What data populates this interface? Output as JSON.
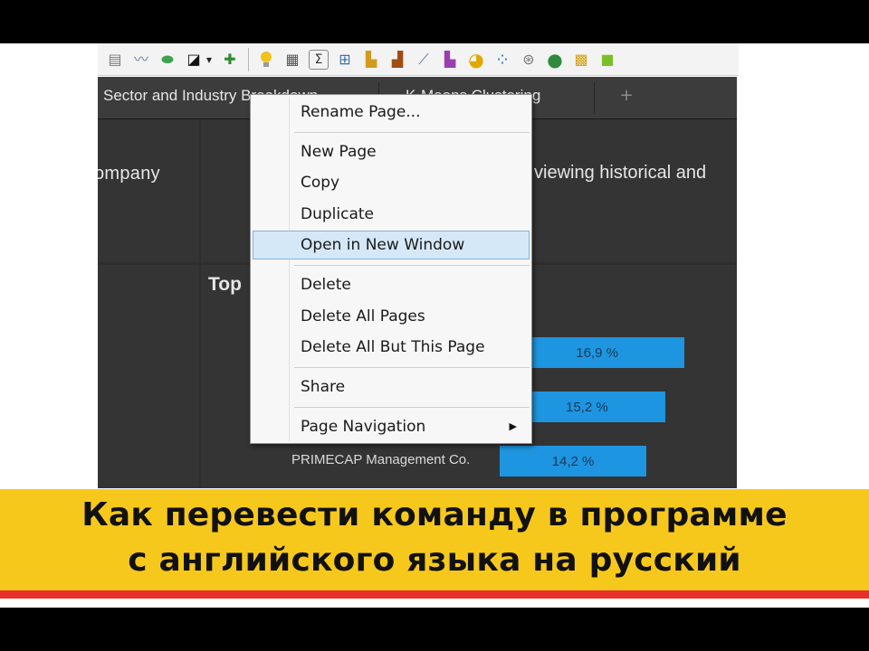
{
  "toolbar": {
    "icons": [
      {
        "name": "bookmark-icon",
        "glyph": "▤",
        "color": "#7a7a7a"
      },
      {
        "name": "line-chart-small-icon",
        "glyph": "〰",
        "color": "#5b7fa7"
      },
      {
        "name": "cloud-icon",
        "glyph": "⬬",
        "color": "#3fa34d"
      },
      {
        "name": "contrast-icon",
        "glyph": "◪",
        "color": "#111111"
      },
      {
        "name": "dropdown-arrow-icon",
        "glyph": "▾",
        "color": "#222222"
      },
      {
        "name": "insert-icon",
        "glyph": "✚",
        "color": "#2e8b2e"
      },
      {
        "name": "lightbulb-icon",
        "glyph": "💡",
        "color": "#e8b100"
      },
      {
        "name": "table-icon",
        "glyph": "▦",
        "color": "#555555"
      },
      {
        "name": "sum-icon",
        "glyph": "Σ",
        "color": "#333333"
      },
      {
        "name": "crosstab-icon",
        "glyph": "⊞",
        "color": "#3d6fa8"
      },
      {
        "name": "bar-chart-icon",
        "glyph": "▙",
        "color": "#d39b1d"
      },
      {
        "name": "column-chart-icon",
        "glyph": "▟",
        "color": "#a04d12"
      },
      {
        "name": "line-chart-icon",
        "glyph": "⟋",
        "color": "#4c6fa0"
      },
      {
        "name": "combo-chart-icon",
        "glyph": "▙",
        "color": "#9b3fb0"
      },
      {
        "name": "pie-chart-icon",
        "glyph": "◕",
        "color": "#e0a800"
      },
      {
        "name": "scatter-icon",
        "glyph": "⁘",
        "color": "#3b7fc4"
      },
      {
        "name": "treemap-icon",
        "glyph": "⊛",
        "color": "#7a7a7a"
      },
      {
        "name": "globe-icon",
        "glyph": "●",
        "color": "#2f8a3e"
      },
      {
        "name": "heatmap-icon",
        "glyph": "▩",
        "color": "#d4a017"
      },
      {
        "name": "summary-icon",
        "glyph": "■",
        "color": "#7bbf2a"
      }
    ]
  },
  "tabs": [
    {
      "label": "Sector and Industry Breakdown"
    },
    {
      "label": "K-Means Clustering"
    }
  ],
  "tab_add_glyph": "+",
  "panels": {
    "company_text": "ompany",
    "desc_text": "viewing historical and",
    "top_text": "Top"
  },
  "bars": [
    {
      "value_label": "16,9 %",
      "label": "",
      "value": 16.9
    },
    {
      "value_label": "15,2 %",
      "label": "",
      "value": 15.2
    },
    {
      "value_label": "14,2 %",
      "label": "PRIMECAP Management Co.",
      "value": 14.2
    }
  ],
  "context_menu": {
    "items": [
      {
        "label": "Rename Page..."
      },
      {
        "label": "New Page"
      },
      {
        "label": "Copy"
      },
      {
        "label": "Duplicate"
      },
      {
        "label": "Open in New Window",
        "highlighted": true
      },
      {
        "label": "Delete"
      },
      {
        "label": "Delete All Pages"
      },
      {
        "label": "Delete All But This Page"
      },
      {
        "label": "Share"
      },
      {
        "label": "Page Navigation",
        "submenu": true
      }
    ],
    "submenu_arrow": "▶"
  },
  "caption": {
    "line1": "Как перевести команду в программе",
    "line2": "с английского языка на русский"
  },
  "colors": {
    "bar": "#1e95e0",
    "banner": "#f7c81c",
    "banner_line": "#e8312b",
    "menu_highlight": "#d5e8f8"
  }
}
